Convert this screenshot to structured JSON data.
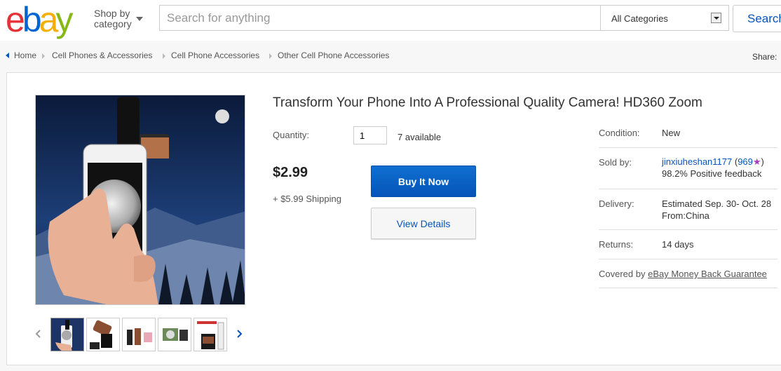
{
  "header": {
    "logo": {
      "e": "e",
      "b": "b",
      "a": "a",
      "y": "y",
      "colors": {
        "e": "#e53238",
        "b": "#0064d2",
        "a": "#f5af02",
        "y": "#86b817"
      }
    },
    "shop_by_line1": "Shop by",
    "shop_by_line2": "category",
    "search_placeholder": "Search for anything",
    "category_selected": "All Categories",
    "search_button": "Search"
  },
  "breadcrumb": {
    "items": [
      "Home",
      "Cell Phones & Accessories",
      "Cell Phone Accessories",
      "Other Cell Phone Accessories"
    ]
  },
  "share_label": "Share:",
  "listing": {
    "title": "Transform Your Phone Into A Professional Quality Camera! HD360 Zoom",
    "quantity_label": "Quantity:",
    "quantity_value": "1",
    "available": "7 available",
    "price": "$2.99",
    "shipping": "+ $5.99 Shipping",
    "buy_now": "Buy It Now",
    "view_details": "View Details"
  },
  "info": {
    "condition_label": "Condition:",
    "condition_value": "New",
    "sold_by_label": "Sold by:",
    "seller": "jinxiuheshan1177",
    "feedback_open": " (",
    "feedback_score": "969",
    "star": "★",
    "feedback_close": ")",
    "positive": "98.2% Positive feedback",
    "delivery_label": "Delivery:",
    "delivery_line1": "Estimated Sep. 30- Oct. 28",
    "delivery_line2": "From:China",
    "returns_label": "Returns:",
    "returns_value": "14 days",
    "covered_prefix": "Covered by ",
    "covered_link": "eBay Money Back Guarantee"
  },
  "colors": {
    "link": "#0654ba",
    "buy_button": "#0654ba",
    "star": "#a73bbf"
  }
}
